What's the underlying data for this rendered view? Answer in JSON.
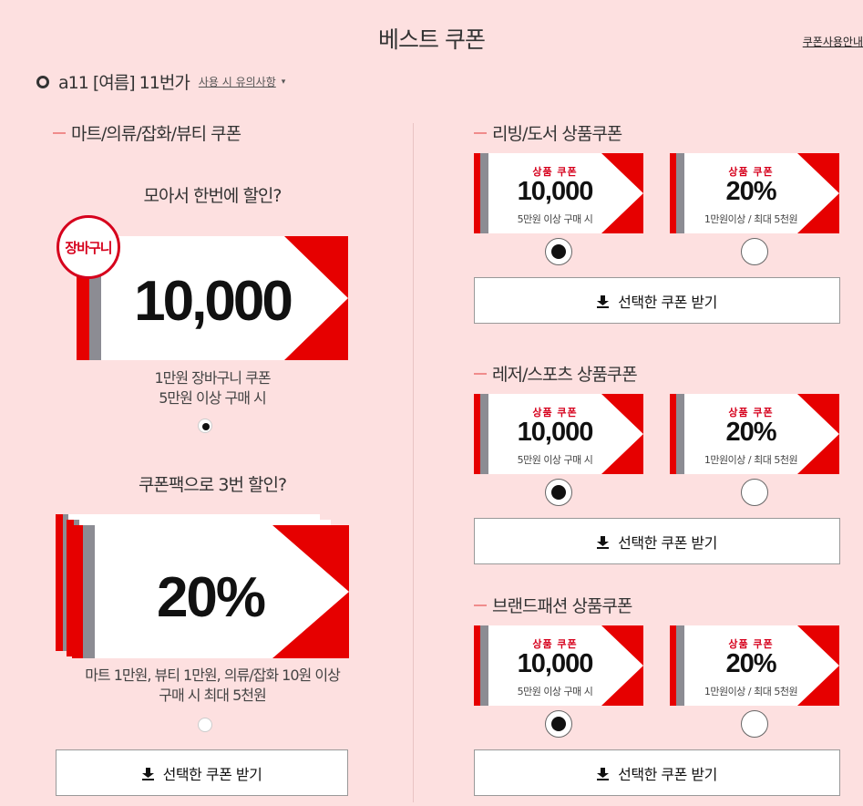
{
  "header": {
    "title": "베스트 쿠폰",
    "guide_link": "쿠폰사용안내"
  },
  "user": {
    "name": "a11 [여름] 11번가",
    "notes_link": "사용 시 유의사항",
    "caret": "▾"
  },
  "left": {
    "section_title": "마트/의류/잡화/뷰티 쿠폰",
    "coupon1": {
      "question": "모아서 한번에 할인?",
      "badge": "장바구니",
      "amount": "10,000",
      "desc_line1": "1만원 장바구니 쿠폰",
      "desc_line2": "5만원 이상 구매 시",
      "selected": true
    },
    "coupon2": {
      "question": "쿠폰팩으로 3번 할인?",
      "amount": "20%",
      "desc_line1": "마트 1만원, 뷰티 1만원, 의류/잡화 10원 이상",
      "desc_line2": "구매 시 최대 5천원",
      "selected": false
    },
    "button_label": "선택한 쿠폰 받기"
  },
  "right": {
    "sections": [
      {
        "title": "리빙/도서 상품쿠폰",
        "coupons": [
          {
            "label": "상품 쿠폰",
            "amount": "10,000",
            "condition": "5만원 이상 구매 시",
            "selected": true
          },
          {
            "label": "상품 쿠폰",
            "amount": "20%",
            "condition": "1만원이상 / 최대 5천원",
            "selected": false
          }
        ],
        "button_label": "선택한 쿠폰 받기"
      },
      {
        "title": "레저/스포츠 상품쿠폰",
        "coupons": [
          {
            "label": "상품 쿠폰",
            "amount": "10,000",
            "condition": "5만원 이상 구매 시",
            "selected": true
          },
          {
            "label": "상품 쿠폰",
            "amount": "20%",
            "condition": "1만원이상 / 최대 5천원",
            "selected": false
          }
        ],
        "button_label": "선택한 쿠폰 받기"
      },
      {
        "title": "브랜드패션 상품쿠폰",
        "coupons": [
          {
            "label": "상품 쿠폰",
            "amount": "10,000",
            "condition": "5만원 이상 구매 시",
            "selected": true
          },
          {
            "label": "상품 쿠폰",
            "amount": "20%",
            "condition": "1만원이상 / 최대 5천원",
            "selected": false
          }
        ],
        "button_label": "선택한 쿠폰 받기"
      }
    ]
  },
  "colors": {
    "background": "#fde0e0",
    "accent_red": "#e60000",
    "stripe_gray": "#8c8c93",
    "label_red": "#d6001c"
  },
  "icons": {
    "download": "download-icon",
    "radio": "radio-icon"
  }
}
